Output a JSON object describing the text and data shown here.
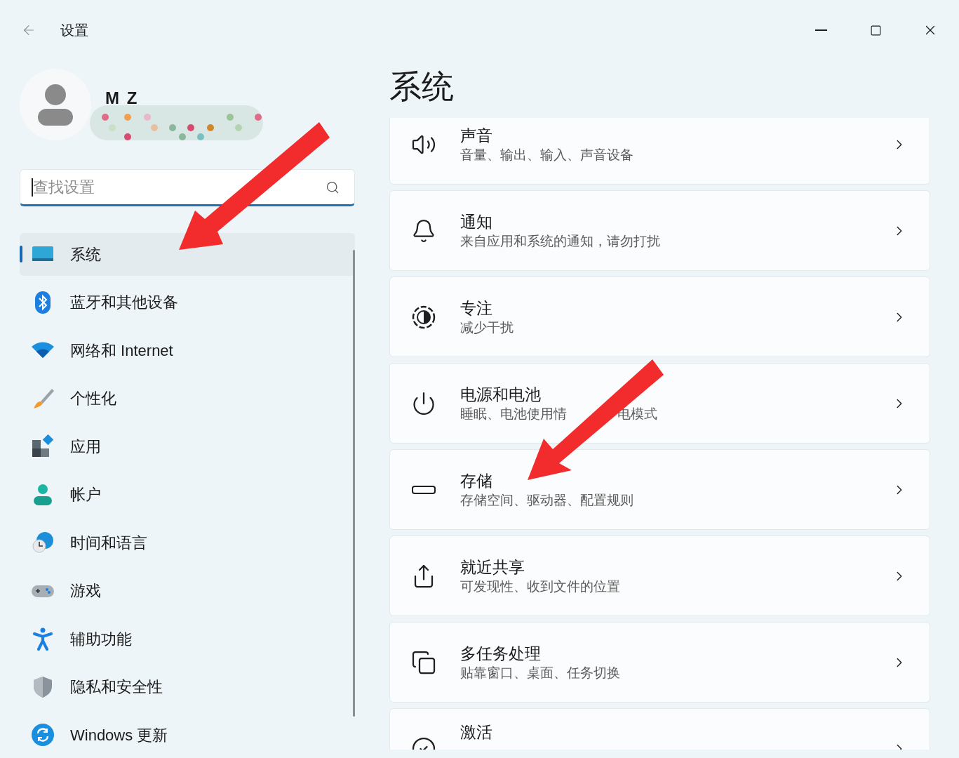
{
  "window": {
    "title": "设置"
  },
  "profile": {
    "name": "M Z"
  },
  "search": {
    "placeholder": "查找设置"
  },
  "nav": [
    {
      "label": "系统",
      "kind": "system",
      "selected": true
    },
    {
      "label": "蓝牙和其他设备",
      "kind": "bluetooth",
      "selected": false
    },
    {
      "label": "网络和 Internet",
      "kind": "wifi",
      "selected": false
    },
    {
      "label": "个性化",
      "kind": "brush",
      "selected": false
    },
    {
      "label": "应用",
      "kind": "apps",
      "selected": false
    },
    {
      "label": "帐户",
      "kind": "account",
      "selected": false
    },
    {
      "label": "时间和语言",
      "kind": "time",
      "selected": false
    },
    {
      "label": "游戏",
      "kind": "game",
      "selected": false
    },
    {
      "label": "辅助功能",
      "kind": "access",
      "selected": false
    },
    {
      "label": "隐私和安全性",
      "kind": "shield",
      "selected": false
    },
    {
      "label": "Windows 更新",
      "kind": "update",
      "selected": false
    }
  ],
  "page": {
    "title": "系统"
  },
  "cards": [
    {
      "title": "声音",
      "subtitle": [
        "音量、输出、输入、声音设备"
      ],
      "kind": "sound"
    },
    {
      "title": "通知",
      "subtitle": [
        "来自应用和系统的通知，请勿打扰"
      ],
      "kind": "bell"
    },
    {
      "title": "专注",
      "subtitle": [
        "减少干扰"
      ],
      "kind": "focus"
    },
    {
      "title": "电源和电池",
      "subtitle": [
        "睡眠、电池使用情",
        "电模式"
      ],
      "kind": "power"
    },
    {
      "title": "存储",
      "subtitle": [
        "存储空间、驱动器、配置规则"
      ],
      "kind": "storage"
    },
    {
      "title": "就近共享",
      "subtitle": [
        "可发现性、收到文件的位置"
      ],
      "kind": "share"
    },
    {
      "title": "多任务处理",
      "subtitle": [
        "贴靠窗口、桌面、任务切换"
      ],
      "kind": "multitask"
    },
    {
      "title": "激活",
      "kind": "activate"
    }
  ]
}
